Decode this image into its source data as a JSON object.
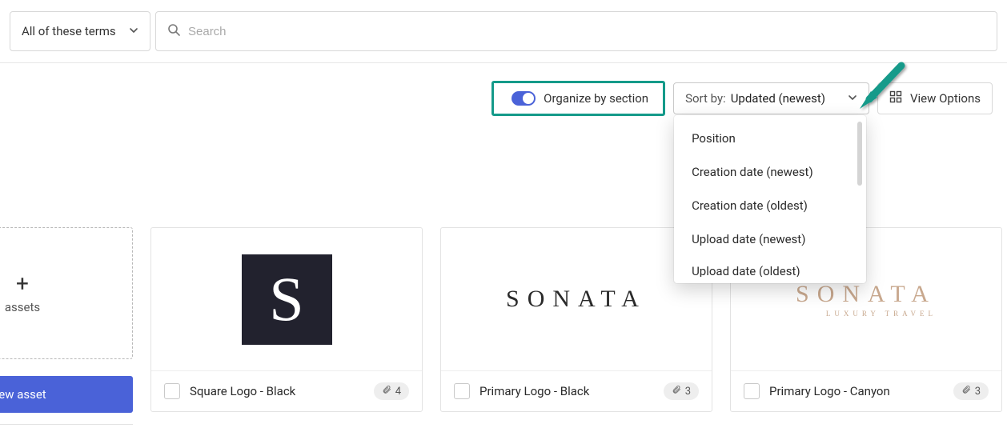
{
  "search": {
    "filter_label": "All of these terms",
    "placeholder": "Search"
  },
  "toolbar": {
    "organize_label": "Organize by section",
    "sort_label": "Sort by:",
    "sort_value": "Updated (newest)",
    "view_options_label": "View Options"
  },
  "sort_menu": {
    "items": [
      "Position",
      "Creation date (newest)",
      "Creation date (oldest)",
      "Upload date (newest)",
      "Upload date (oldest)"
    ]
  },
  "add_card": {
    "label": "assets"
  },
  "assets": [
    {
      "name": "Square Logo - Black",
      "count": "4"
    },
    {
      "name": "Primary Logo - Black",
      "count": "3"
    },
    {
      "name": "Primary Logo - Canyon",
      "count": "3"
    }
  ],
  "brand_text": {
    "sonata": "SONATA",
    "sub": "LUXURY TRAVEL",
    "s": "S"
  },
  "new_asset_label": "ew asset"
}
